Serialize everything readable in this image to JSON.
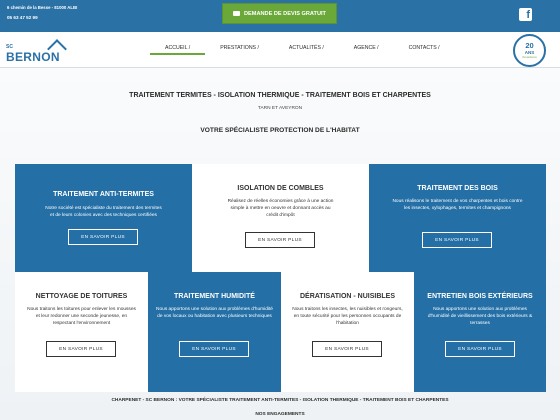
{
  "topbar": {
    "address": "6 chemin de la Besse - 81000 ALBI",
    "phone": "05 63 47 52 99",
    "quote_button": "DEMANDE DE DEVIS GRATUIT",
    "facebook_icon": "facebook-icon"
  },
  "brand": {
    "prefix": "SC",
    "name": "BERNON"
  },
  "nav": [
    "ACCUEIL",
    "PRESTATIONS",
    "ACTUALITÉS",
    "AGENCE",
    "CONTACTS"
  ],
  "badge": {
    "number": "20",
    "label": "ANS",
    "sub": "d'expérience"
  },
  "hero": {
    "title": "TRAITEMENT TERMITES - ISOLATION THERMIQUE - TRAITEMENT BOIS ET CHARPENTES",
    "subtitle": "TARN ET AVEYRON",
    "heading": "VOTRE SPÉCIALISTE PROTECTION DE L'HABITAT"
  },
  "cards_row1": [
    {
      "title": "TRAITEMENT ANTI-TERMITES",
      "text": "Notre société est spécialiste du traitement des termites et de leurs colonies avec des techniques certifiées",
      "button": "EN SAVOIR PLUS"
    },
    {
      "title": "ISOLATION DE COMBLES",
      "text": "Réalisez de réelles économies grâce à une action simple à mettre en oeuvre et donnant accès au crédit d'impôt",
      "button": "EN SAVOIR PLUS"
    },
    {
      "title": "TRAITEMENT DES BOIS",
      "text": "Nous réalisons le traitement de vos charpentes et bois contre les insectes, xylophages, termites et champignons",
      "button": "EN SAVOIR PLUS"
    }
  ],
  "cards_row2": [
    {
      "title": "NETTOYAGE DE TOITURES",
      "text": "Nous traitons les toitures pour enlever les mousses et leur redonner une seconde jeunesse, en respectant l'environnement",
      "button": "EN SAVOIR PLUS"
    },
    {
      "title": "TRAITEMENT HUMIDITÉ",
      "text": "Nous apportons une solution aux problèmes d'humidité de vos locaux ou habitation avec plusieurs techniques",
      "button": "EN SAVOIR PLUS"
    },
    {
      "title": "DÉRATISATION - NUISIBLES",
      "text": "Nous traitons les insectes, les nuisibles et rongeurs, en toute sécurité pour les personnes occupants de l'habitation",
      "button": "EN SAVOIR PLUS"
    },
    {
      "title": "ENTRETIEN BOIS EXTÉRIEURS",
      "text": "Nous apportons une solution aux problèmes d'humidité de vieillissement des bois extérieurs & terrasses",
      "button": "EN SAVOIR PLUS"
    }
  ],
  "footer_strip": "CHARPENET - SC BERNON : VOTRE SPÉCIALISTE TRAITEMENT ANTI-TERMITES - ISOLATION THERMIQUE - TRAITEMENT BOIS ET CHARPENTES",
  "footer_strip2": "NOS ENGAGEMENTS",
  "colors": {
    "primary": "#246fa6",
    "accent": "#6aa83a"
  }
}
